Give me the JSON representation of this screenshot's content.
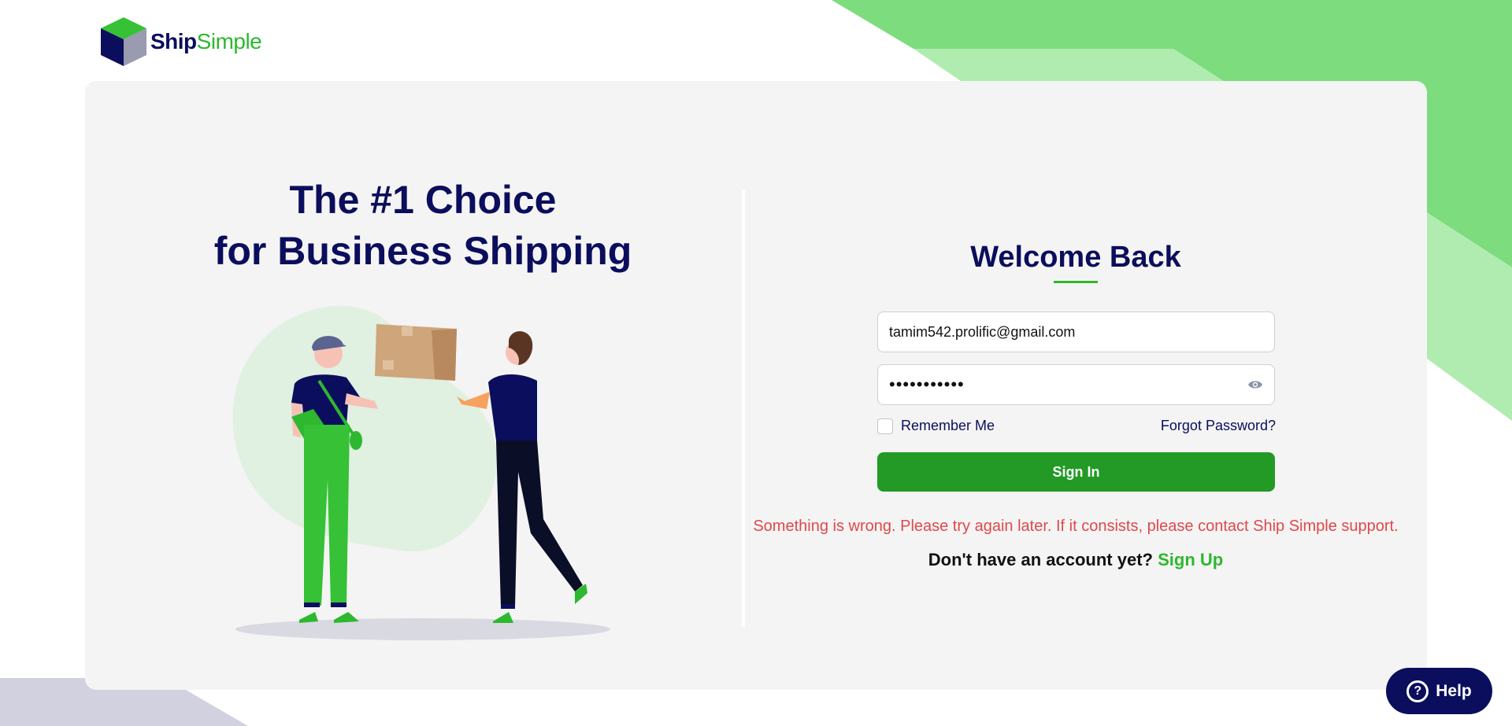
{
  "brand": {
    "name_part1": "Ship",
    "name_part2": "Simple",
    "icon": "cube-logo-icon"
  },
  "hero": {
    "headline_line1": "The #1 Choice",
    "headline_line2": "for Business Shipping",
    "illustration": "delivery-people-illustration"
  },
  "login": {
    "title": "Welcome Back",
    "email_value": "tamim542.prolific@gmail.com",
    "password_value": "•••••••••••",
    "password_toggle_icon": "eye-icon",
    "remember_label": "Remember Me",
    "remember_checked": false,
    "forgot_label": "Forgot Password?",
    "signin_label": "Sign In",
    "error_message": "Something is wrong. Please try again later. If it consists, please contact Ship Simple support.",
    "signup_prompt": "Don't have an account yet?",
    "signup_link": "Sign Up"
  },
  "help": {
    "label": "Help",
    "icon": "question-circle-icon",
    "icon_glyph": "?"
  },
  "colors": {
    "navy": "#0b0e5c",
    "green": "#2db82f",
    "button_green": "#229a25",
    "error_red": "#e0484a",
    "card_bg": "#f4f4f4"
  }
}
